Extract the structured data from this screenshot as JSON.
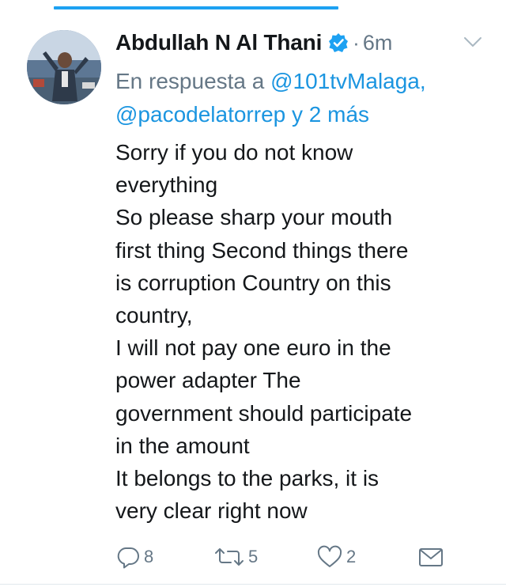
{
  "tweet": {
    "author_name": "Abdullah N Al Thani",
    "separator": "·",
    "time": "6m",
    "reply_prefix": "En respuesta a",
    "reply_mention_1": "@101tvMalaga,",
    "reply_mention_2": "@pacodelatorrep",
    "reply_suffix": "y 2 más",
    "text_lines": [
      "Sorry if you do not know",
      "everything",
      "So please sharp your mouth",
      "first thing Second things there",
      "is corruption Country on this",
      "country,",
      "I will not pay one euro in the",
      "power adapter The",
      "government should participate",
      "in the amount",
      "It belongs to the parks, it is",
      "very clear right now"
    ],
    "actions": {
      "reply_count": "8",
      "retweet_count": "5",
      "like_count": "2"
    }
  },
  "icons": {
    "verified": "verified-badge-icon",
    "menu": "chevron-down-icon",
    "reply": "reply-icon",
    "retweet": "retweet-icon",
    "like": "heart-icon",
    "message": "envelope-icon"
  },
  "colors": {
    "accent": "#1da1f2",
    "link": "#1b95e0",
    "secondary_text": "#657786",
    "primary_text": "#14171a"
  }
}
